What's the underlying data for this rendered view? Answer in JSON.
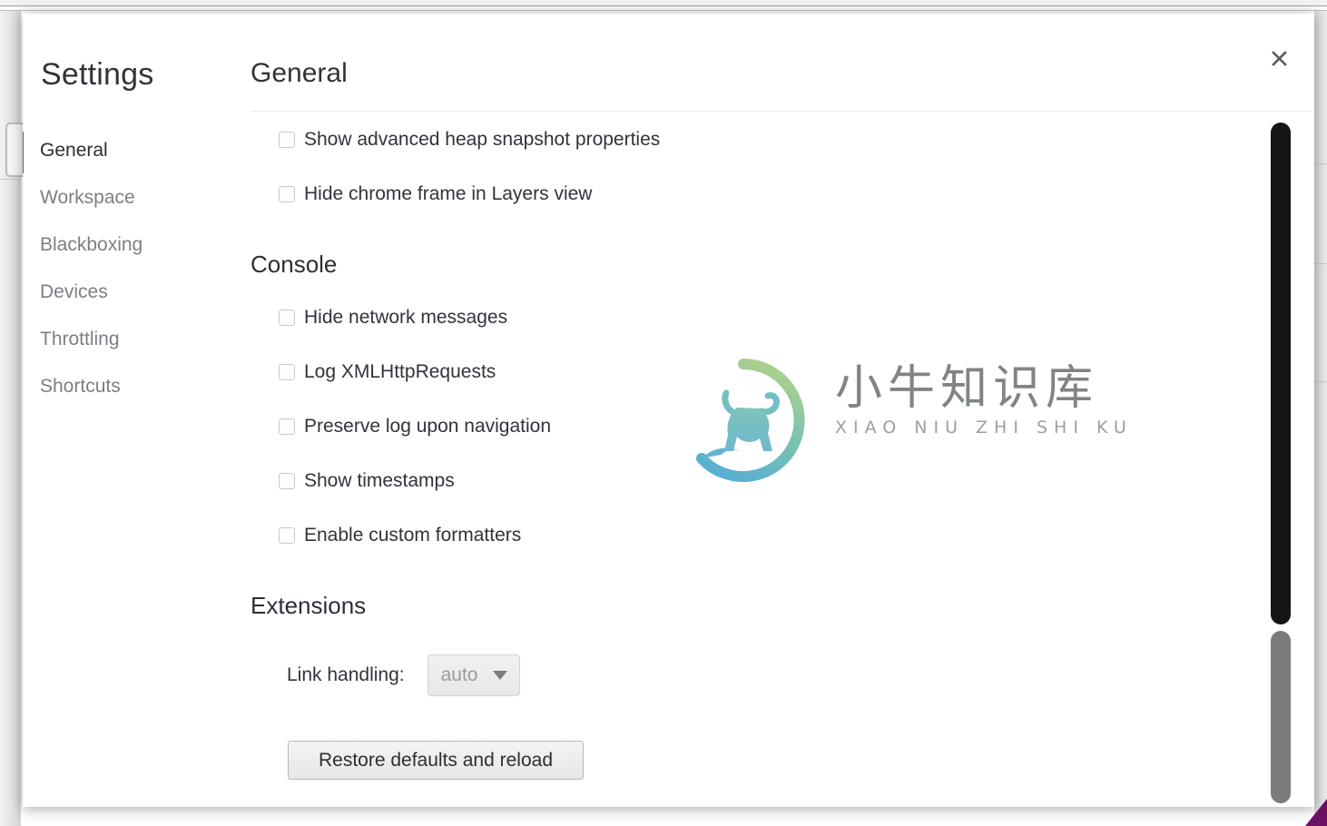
{
  "window": {
    "close_label": "×"
  },
  "sidebar": {
    "title": "Settings",
    "items": [
      {
        "label": "General",
        "selected": true
      },
      {
        "label": "Workspace",
        "selected": false
      },
      {
        "label": "Blackboxing",
        "selected": false
      },
      {
        "label": "Devices",
        "selected": false
      },
      {
        "label": "Throttling",
        "selected": false
      },
      {
        "label": "Shortcuts",
        "selected": false
      }
    ]
  },
  "main": {
    "page_title": "General",
    "top_checkboxes": [
      {
        "label": "Show advanced heap snapshot properties",
        "checked": false
      },
      {
        "label": "Hide chrome frame in Layers view",
        "checked": false
      }
    ],
    "console": {
      "heading": "Console",
      "checkboxes": [
        {
          "label": "Hide network messages",
          "checked": false
        },
        {
          "label": "Log XMLHttpRequests",
          "checked": false
        },
        {
          "label": "Preserve log upon navigation",
          "checked": false
        },
        {
          "label": "Show timestamps",
          "checked": false
        },
        {
          "label": "Enable custom formatters",
          "checked": false
        }
      ]
    },
    "extensions": {
      "heading": "Extensions",
      "link_handling_label": "Link handling:",
      "link_handling_value": "auto",
      "link_handling_options": [
        "auto"
      ]
    },
    "restore_button": "Restore defaults and reload"
  },
  "watermark": {
    "chinese": "小牛知识库",
    "pinyin": "XIAO NIU ZHI SHI KU"
  },
  "colors": {
    "text_primary": "#30343a",
    "text_muted": "#7b7f84",
    "selection_bar": "#5f6368",
    "divider": "#ececec",
    "scrollbar_thumb": "#7b7b7b",
    "watermark_green": "#9ccb8f",
    "watermark_blue": "#5eaed2",
    "accent_purple": "#6d1166"
  }
}
